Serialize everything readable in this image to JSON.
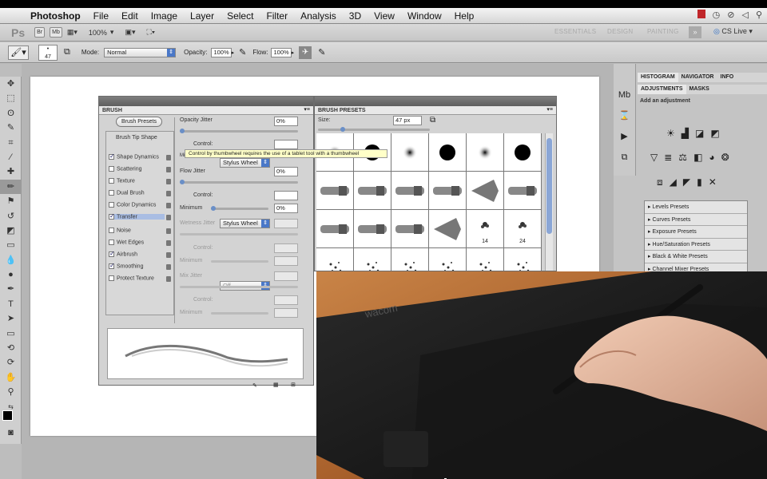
{
  "menubar": {
    "app": "Photoshop",
    "items": [
      "File",
      "Edit",
      "Image",
      "Layer",
      "Select",
      "Filter",
      "Analysis",
      "3D",
      "View",
      "Window",
      "Help"
    ]
  },
  "appbar": {
    "ps": "Ps",
    "br": "Br",
    "mb": "Mb",
    "zoom": "100%",
    "workspaces": [
      "ESSENTIALS",
      "DESIGN",
      "PAINTING"
    ],
    "cslive": "CS Live"
  },
  "options": {
    "brush_size": "47",
    "mode_label": "Mode:",
    "mode_value": "Normal",
    "opacity_label": "Opacity:",
    "opacity_value": "100%",
    "flow_label": "Flow:",
    "flow_value": "100%"
  },
  "brush_panel": {
    "title": "BRUSH",
    "presets_button": "Brush Presets",
    "tip_shape": "Brush Tip Shape",
    "options": [
      {
        "label": "Shape Dynamics",
        "checked": true
      },
      {
        "label": "Scattering",
        "checked": false
      },
      {
        "label": "Texture",
        "checked": false
      },
      {
        "label": "Dual Brush",
        "checked": false
      },
      {
        "label": "Color Dynamics",
        "checked": false
      },
      {
        "label": "Transfer",
        "checked": true
      },
      {
        "label": "Noise",
        "checked": false
      },
      {
        "label": "Wet Edges",
        "checked": false
      },
      {
        "label": "Airbrush",
        "checked": true
      },
      {
        "label": "Smoothing",
        "checked": true
      },
      {
        "label": "Protect Texture",
        "checked": false
      }
    ],
    "opacity_jitter": "Opacity Jitter",
    "opacity_jitter_value": "0%",
    "control_label": "Control:",
    "control_value": "Stylus Wheel",
    "tooltip": "Control by thumbwheel requires the use of a tablet tool with a thumbwheel",
    "flow_jitter": "Flow Jitter",
    "flow_jitter_value": "0%",
    "minimum_label": "Minimum",
    "minimum_value": "0%",
    "mi_label": "Mi",
    "wetness_jitter": "Wetness Jitter",
    "mix_jitter": "Mix Jitter",
    "off_value": "Off"
  },
  "presets_panel": {
    "title": "BRUSH PRESETS",
    "size_label": "Size:",
    "size_value": "47 px",
    "cell_labels": [
      "14",
      "24"
    ]
  },
  "dock": {
    "tabs": [
      "HISTOGRAM",
      "NAVIGATOR",
      "INFO"
    ],
    "subtabs": [
      "ADJUSTMENTS",
      "MASKS"
    ],
    "add_adjustment": "Add an adjustment",
    "presets": [
      "Levels Presets",
      "Curves Presets",
      "Exposure Presets",
      "Hue/Saturation Presets",
      "Black & White Presets",
      "Channel Mixer Presets"
    ]
  },
  "photo": {
    "brand": "wacom"
  }
}
